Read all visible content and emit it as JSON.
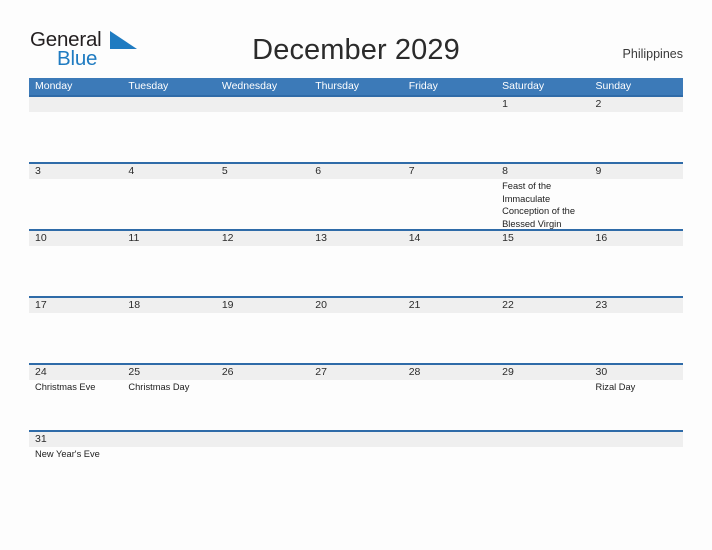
{
  "brand": {
    "word_one": "General",
    "word_two": "Blue",
    "flag_icon": "blue-flag-triangle",
    "color_dark": "#231f20",
    "color_blue": "#1f7bc1"
  },
  "header": {
    "title": "December 2029",
    "locale": "Philippines"
  },
  "theme": {
    "header_blue": "#3c7ab8",
    "rule_blue": "#2f6ba8",
    "daynum_band": "#efefef",
    "page_background": "#fdfdfd"
  },
  "calendar": {
    "month": "December",
    "year": "2029",
    "weekday_headers": [
      "Monday",
      "Tuesday",
      "Wednesday",
      "Thursday",
      "Friday",
      "Saturday",
      "Sunday"
    ],
    "weeks": [
      {
        "days": [
          {
            "num": "",
            "event": ""
          },
          {
            "num": "",
            "event": ""
          },
          {
            "num": "",
            "event": ""
          },
          {
            "num": "",
            "event": ""
          },
          {
            "num": "",
            "event": ""
          },
          {
            "num": "1",
            "event": ""
          },
          {
            "num": "2",
            "event": ""
          }
        ]
      },
      {
        "days": [
          {
            "num": "3",
            "event": ""
          },
          {
            "num": "4",
            "event": ""
          },
          {
            "num": "5",
            "event": ""
          },
          {
            "num": "6",
            "event": ""
          },
          {
            "num": "7",
            "event": ""
          },
          {
            "num": "8",
            "event": "Feast of the Immaculate Conception of the Blessed Virgin"
          },
          {
            "num": "9",
            "event": ""
          }
        ]
      },
      {
        "days": [
          {
            "num": "10",
            "event": ""
          },
          {
            "num": "11",
            "event": ""
          },
          {
            "num": "12",
            "event": ""
          },
          {
            "num": "13",
            "event": ""
          },
          {
            "num": "14",
            "event": ""
          },
          {
            "num": "15",
            "event": ""
          },
          {
            "num": "16",
            "event": ""
          }
        ]
      },
      {
        "days": [
          {
            "num": "17",
            "event": ""
          },
          {
            "num": "18",
            "event": ""
          },
          {
            "num": "19",
            "event": ""
          },
          {
            "num": "20",
            "event": ""
          },
          {
            "num": "21",
            "event": ""
          },
          {
            "num": "22",
            "event": ""
          },
          {
            "num": "23",
            "event": ""
          }
        ]
      },
      {
        "days": [
          {
            "num": "24",
            "event": "Christmas Eve"
          },
          {
            "num": "25",
            "event": "Christmas Day"
          },
          {
            "num": "26",
            "event": ""
          },
          {
            "num": "27",
            "event": ""
          },
          {
            "num": "28",
            "event": ""
          },
          {
            "num": "29",
            "event": ""
          },
          {
            "num": "30",
            "event": "Rizal Day"
          }
        ]
      },
      {
        "days": [
          {
            "num": "31",
            "event": "New Year's Eve"
          },
          {
            "num": "",
            "event": ""
          },
          {
            "num": "",
            "event": ""
          },
          {
            "num": "",
            "event": ""
          },
          {
            "num": "",
            "event": ""
          },
          {
            "num": "",
            "event": ""
          },
          {
            "num": "",
            "event": ""
          }
        ]
      }
    ]
  }
}
